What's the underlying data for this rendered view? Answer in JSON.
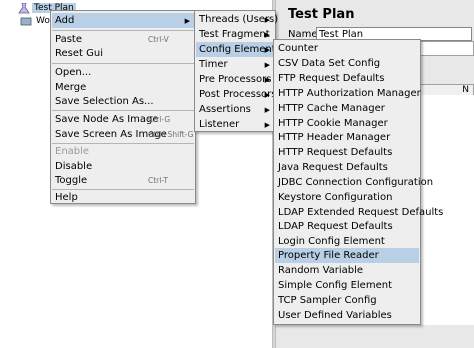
{
  "tree": {
    "items": [
      {
        "label": "Test Plan",
        "selected": true
      },
      {
        "label": "Work"
      }
    ]
  },
  "right_panel": {
    "title": "Test Plan",
    "name_label": "Name:",
    "name_value": "Test Plan",
    "column_header": "N"
  },
  "context_menu": {
    "items": [
      {
        "label": "Add",
        "shortcut": "",
        "submenu": true,
        "highlighted": true
      },
      {
        "label": "Paste",
        "shortcut": "Ctrl-V"
      },
      {
        "label": "Reset Gui",
        "shortcut": ""
      },
      {
        "label": "Open...",
        "shortcut": ""
      },
      {
        "label": "Merge",
        "shortcut": ""
      },
      {
        "label": "Save Selection As...",
        "shortcut": ""
      },
      {
        "label": "Save Node As Image",
        "shortcut": "Ctrl-G"
      },
      {
        "label": "Save Screen As Image",
        "shortcut": "Ctrl+Shift-G"
      },
      {
        "label": "Enable",
        "shortcut": "",
        "disabled": true
      },
      {
        "label": "Disable",
        "shortcut": ""
      },
      {
        "label": "Toggle",
        "shortcut": "Ctrl-T"
      },
      {
        "label": "Help",
        "shortcut": ""
      }
    ]
  },
  "add_submenu": {
    "items": [
      {
        "label": "Threads (Users)"
      },
      {
        "label": "Test Fragment"
      },
      {
        "label": "Config Element",
        "highlighted": true
      },
      {
        "label": "Timer"
      },
      {
        "label": "Pre Processors"
      },
      {
        "label": "Post Processors"
      },
      {
        "label": "Assertions"
      },
      {
        "label": "Listener"
      }
    ]
  },
  "config_submenu": {
    "items": [
      {
        "label": "Counter"
      },
      {
        "label": "CSV Data Set Config"
      },
      {
        "label": "FTP Request Defaults"
      },
      {
        "label": "HTTP Authorization Manager"
      },
      {
        "label": "HTTP Cache Manager"
      },
      {
        "label": "HTTP Cookie Manager"
      },
      {
        "label": "HTTP Header Manager"
      },
      {
        "label": "HTTP Request Defaults"
      },
      {
        "label": "Java Request Defaults"
      },
      {
        "label": "JDBC Connection Configuration"
      },
      {
        "label": "Keystore Configuration"
      },
      {
        "label": "LDAP Extended Request Defaults"
      },
      {
        "label": "LDAP Request Defaults"
      },
      {
        "label": "Login Config Element"
      },
      {
        "label": "Property File Reader",
        "highlighted": true
      },
      {
        "label": "Random Variable"
      },
      {
        "label": "Simple Config Element"
      },
      {
        "label": "TCP Sampler Config"
      },
      {
        "label": "User Defined Variables"
      }
    ]
  },
  "colors": {
    "highlight": "#b8cfe5",
    "menu_bg": "#eeeeee",
    "shortcut_text": "#6e6e6e",
    "disabled_text": "#9a9a9a"
  }
}
